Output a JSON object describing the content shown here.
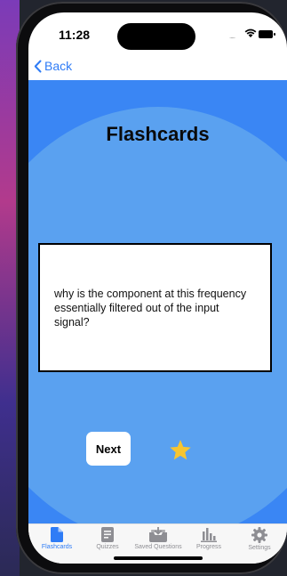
{
  "status_bar": {
    "time": "11:28",
    "signal_dots": "....."
  },
  "nav": {
    "back_label": "Back"
  },
  "page": {
    "title": "Flashcards"
  },
  "flashcard": {
    "text": "why is the component at this frequency essentially filtered out of the input signal?"
  },
  "controls": {
    "next_label": "Next",
    "star_icon": "star-icon",
    "star_color": "#f7c531"
  },
  "tabs": [
    {
      "label": "Flashcards",
      "icon": "document-icon",
      "active": true
    },
    {
      "label": "Quizzes",
      "icon": "clipboard-icon",
      "active": false
    },
    {
      "label": "Saved Questions",
      "icon": "tray-download-icon",
      "active": false
    },
    {
      "label": "Progress",
      "icon": "bar-chart-icon",
      "active": false
    },
    {
      "label": "Settings",
      "icon": "gear-icon",
      "active": false
    }
  ],
  "colors": {
    "accent": "#2f7cf6",
    "content_bg": "#3a86f4",
    "circle_bg": "#5aa1f0",
    "inactive_tab": "#8e8e93"
  }
}
